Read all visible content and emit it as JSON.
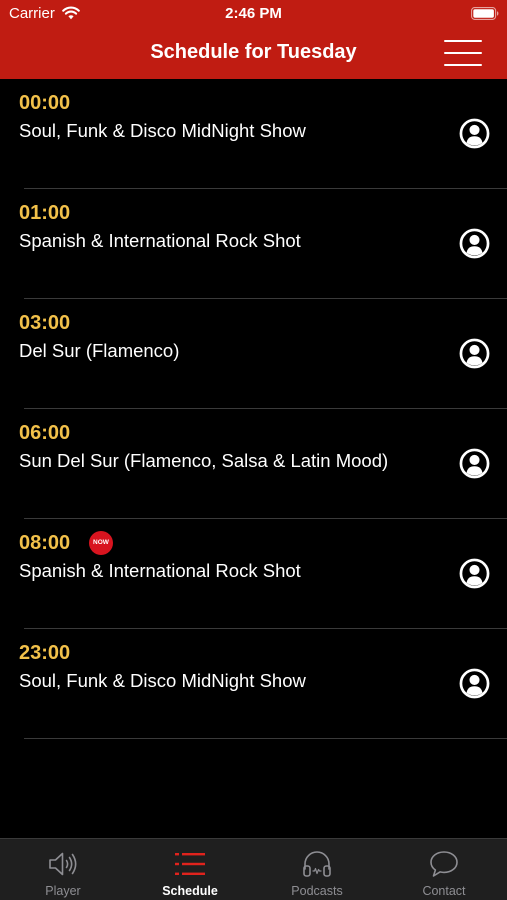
{
  "status_bar": {
    "carrier": "Carrier",
    "time": "2:46 PM",
    "icons": [
      "wifi-icon",
      "battery-icon"
    ]
  },
  "header": {
    "title": "Schedule for Tuesday",
    "menu_icon": "hamburger-menu-icon",
    "background_color": "#c01c12"
  },
  "schedule": {
    "items": [
      {
        "time": "00:00",
        "show": "Soul, Funk & Disco MidNight Show",
        "now": false
      },
      {
        "time": "01:00",
        "show": "Spanish & International Rock Shot",
        "now": false
      },
      {
        "time": "03:00",
        "show": "Del Sur (Flamenco)",
        "now": false
      },
      {
        "time": "06:00",
        "show": "Sun Del Sur (Flamenco, Salsa & Latin Mood)",
        "now": false
      },
      {
        "time": "08:00",
        "show": "Spanish & International Rock Shot",
        "now": true,
        "badge": "NOW"
      },
      {
        "time": "23:00",
        "show": "Soul, Funk & Disco MidNight Show",
        "now": false
      }
    ],
    "time_color": "#f2c14a",
    "badge_color": "#d8141f",
    "host_icon": "person-circle-icon"
  },
  "tabbar": {
    "tabs": [
      {
        "label": "Player",
        "icon": "speaker-icon",
        "active": false
      },
      {
        "label": "Schedule",
        "icon": "list-icon",
        "active": true
      },
      {
        "label": "Podcasts",
        "icon": "headphones-icon",
        "active": false
      },
      {
        "label": "Contact",
        "icon": "chat-bubble-icon",
        "active": false
      }
    ],
    "active_color": "#e0231d"
  }
}
